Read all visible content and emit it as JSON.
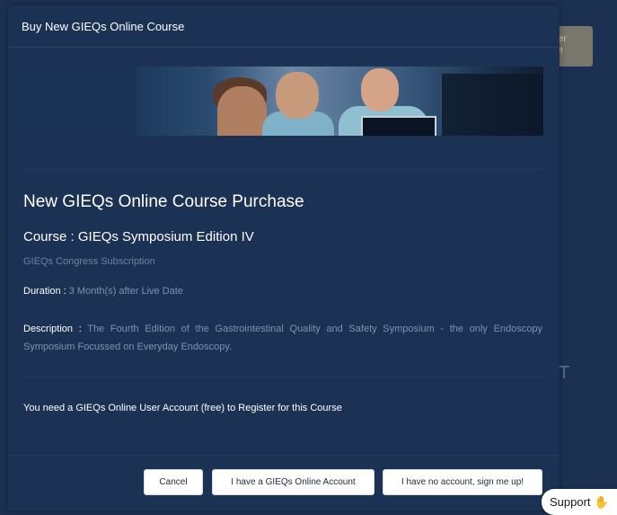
{
  "modal": {
    "title": "Buy New GIEQs Online Course",
    "purchase_title": "New GIEQs Online Course Purchase",
    "course_title": "Course : GIEQs Symposium Edition IV",
    "course_subtitle": "GIEQs Congress Subscription",
    "duration_label": "Duration :",
    "duration_value": " 3 Month(s) after Live Date",
    "description_label": "Description :",
    "description_value": " The Fourth Edition of the Gastrointestinal Quality and Safety Symposium - the only Endoscopy Symposium Focussed on Everyday Endoscopy.",
    "account_note": "You need a GIEQs Online User Account (free) to Register for this Course",
    "buttons": {
      "cancel": "Cancel",
      "have_account": "I have a GIEQs Online Account",
      "no_account": "I have no account, sign me up!"
    }
  },
  "background": {
    "register_button_text": "ter\nv!",
    "letter": "T"
  },
  "support": {
    "label": "Support",
    "icon": "waving-hand-icon"
  },
  "colors": {
    "modal_bg": "#1c3255",
    "muted_text": "#7f91ad",
    "button_bg": "#ffffff"
  }
}
